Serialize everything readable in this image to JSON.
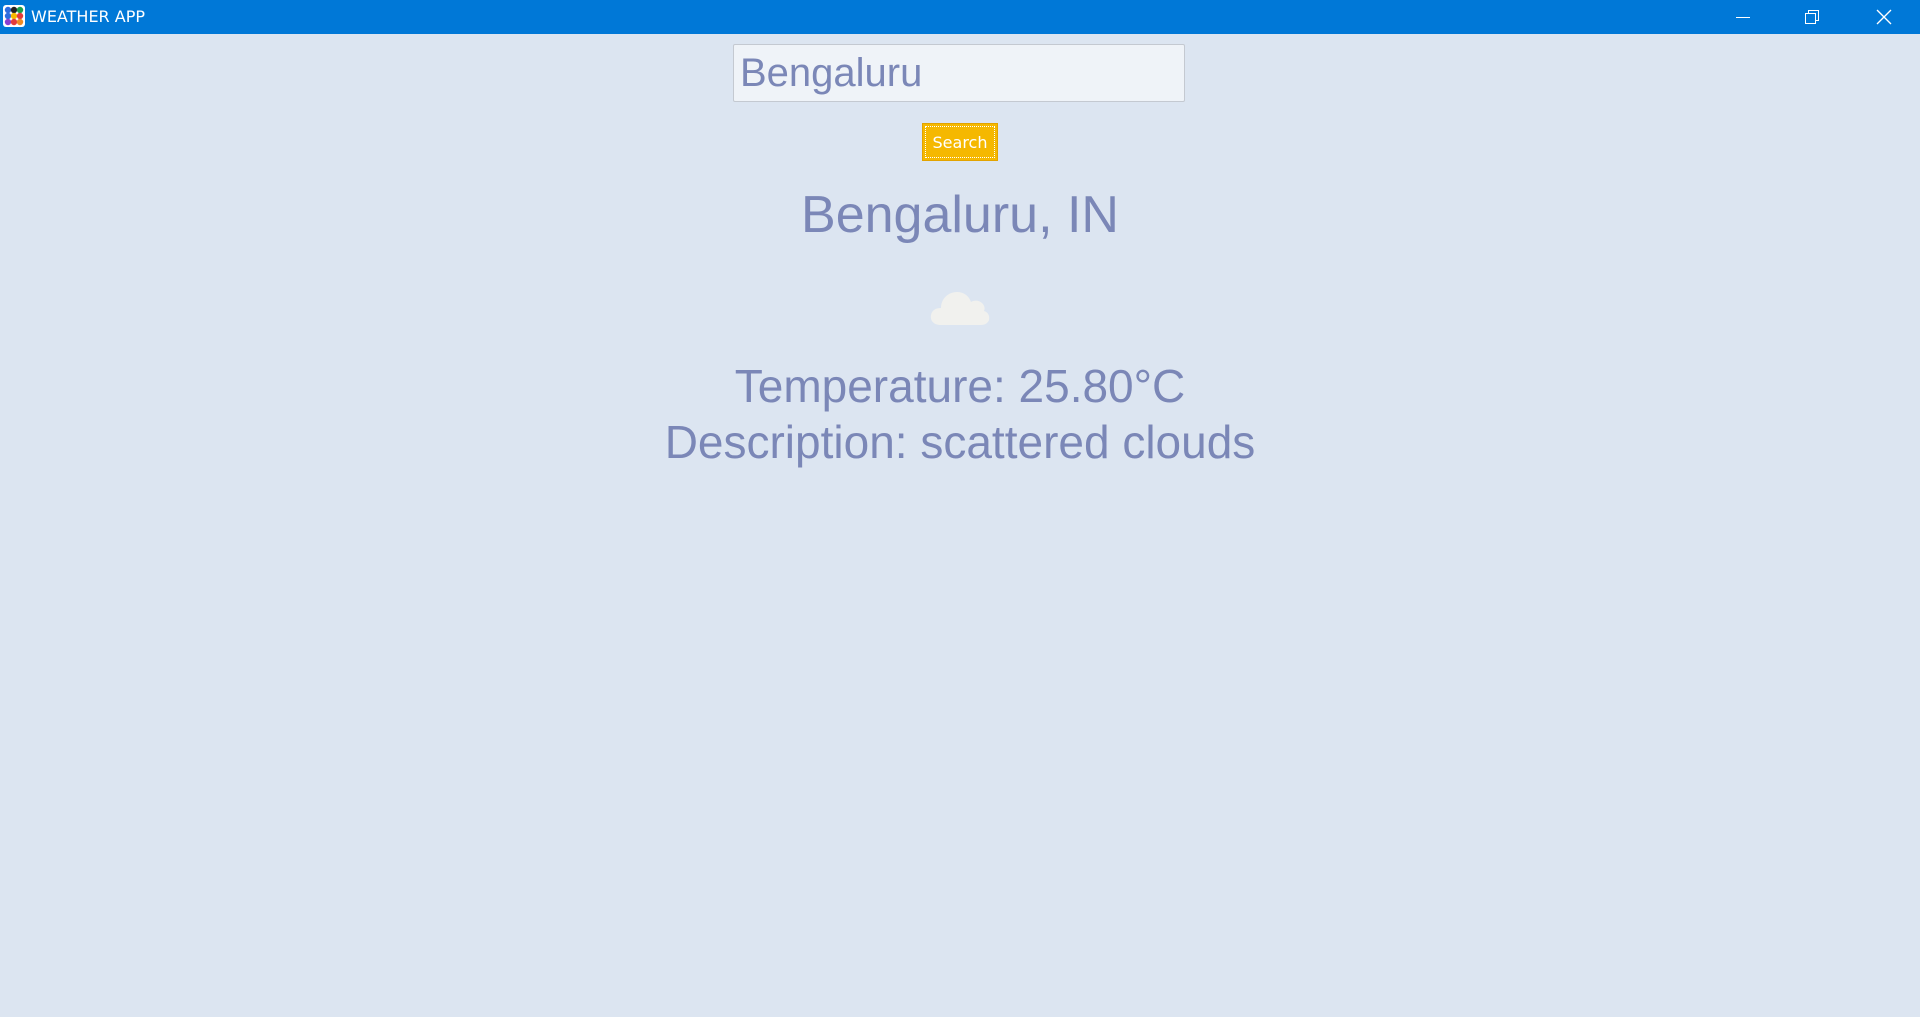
{
  "window": {
    "title": "WEATHER APP",
    "accent_color": "#0078d7",
    "background_color": "#dce5f1",
    "app_icon": "colored-dots-icon",
    "controls": [
      "minimize-icon",
      "restore-icon",
      "close-icon"
    ]
  },
  "search": {
    "value": "Bengaluru",
    "button_label": "Search",
    "button_color": "#f5b800"
  },
  "weather": {
    "location": "Bengaluru, IN",
    "icon": "cloud-icon",
    "temperature_text": "Temperature: 25.80°C",
    "description_text": "Description: scattered clouds",
    "text_color": "#7b87b7"
  }
}
